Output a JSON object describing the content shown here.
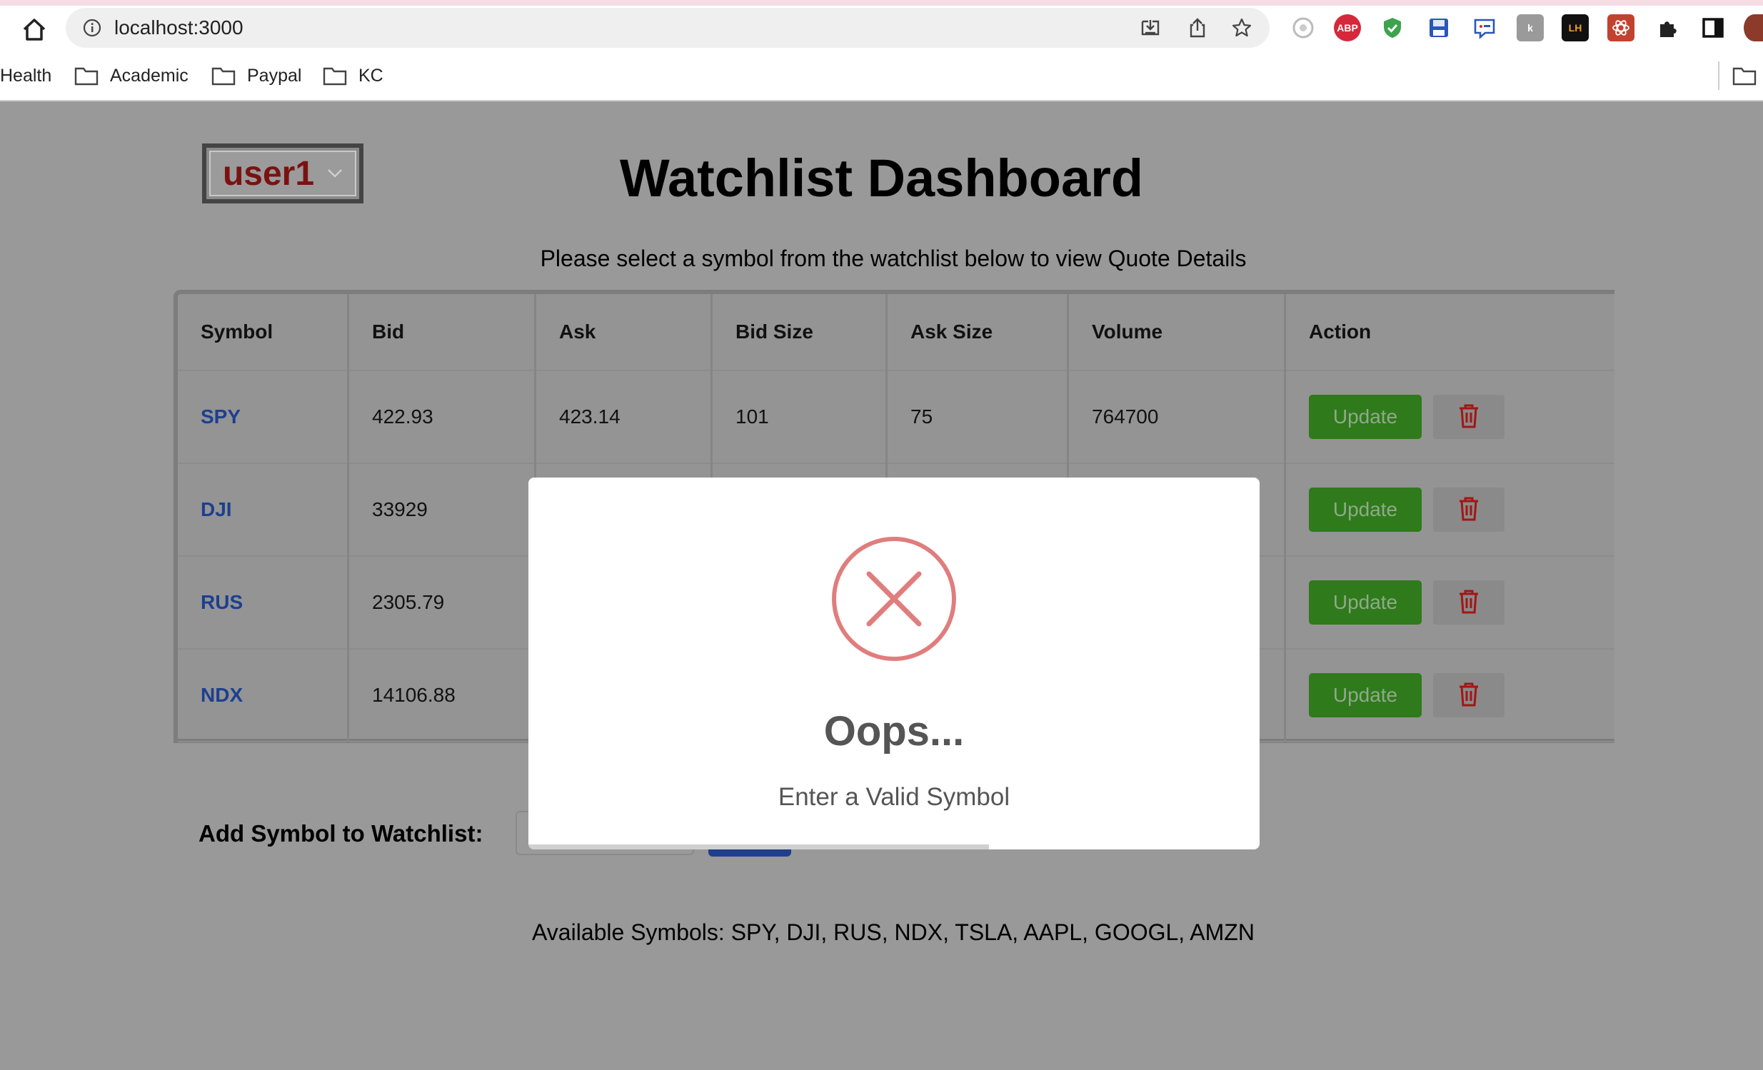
{
  "browser": {
    "url": "localhost:3000",
    "bookmarks": [
      "Health",
      "Academic",
      "Paypal",
      "KC"
    ],
    "extensions": [
      "ABP",
      "LH"
    ]
  },
  "header": {
    "user_select_value": "user1",
    "title": "Watchlist Dashboard",
    "subtitle": "Please select a symbol from the watchlist below to view Quote Details"
  },
  "table": {
    "headers": [
      "Symbol",
      "Bid",
      "Ask",
      "Bid Size",
      "Ask Size",
      "Volume",
      "Action"
    ],
    "rows": [
      {
        "symbol": "SPY",
        "bid": "422.93",
        "ask": "423.14",
        "bid_size": "101",
        "ask_size": "75",
        "volume": "764700"
      },
      {
        "symbol": "DJI",
        "bid": "33929",
        "ask": "",
        "bid_size": "",
        "ask_size": "",
        "volume": ""
      },
      {
        "symbol": "RUS",
        "bid": "2305.79",
        "ask": "",
        "bid_size": "",
        "ask_size": "",
        "volume": ""
      },
      {
        "symbol": "NDX",
        "bid": "14106.88",
        "ask": "",
        "bid_size": "",
        "ask_size": "",
        "volume": ""
      }
    ],
    "update_label": "Update",
    "delete_icon": "trash-icon"
  },
  "add_form": {
    "label": "Add Symbol to Watchlist:",
    "input_value": ""
  },
  "available_symbols": "Available Symbols: SPY, DJI, RUS, NDX, TSLA, AAPL, GOOGL, AMZN",
  "modal": {
    "icon": "error-x-icon",
    "title": "Oops...",
    "message": "Enter a Valid Symbol",
    "timer_progress": 0.63
  },
  "colors": {
    "overlay": "#999999",
    "update_button": "#2f7a1b",
    "symbol_link": "#1d3f8f",
    "error_icon": "#e07d7d",
    "user_select_text": "#7a1212"
  }
}
